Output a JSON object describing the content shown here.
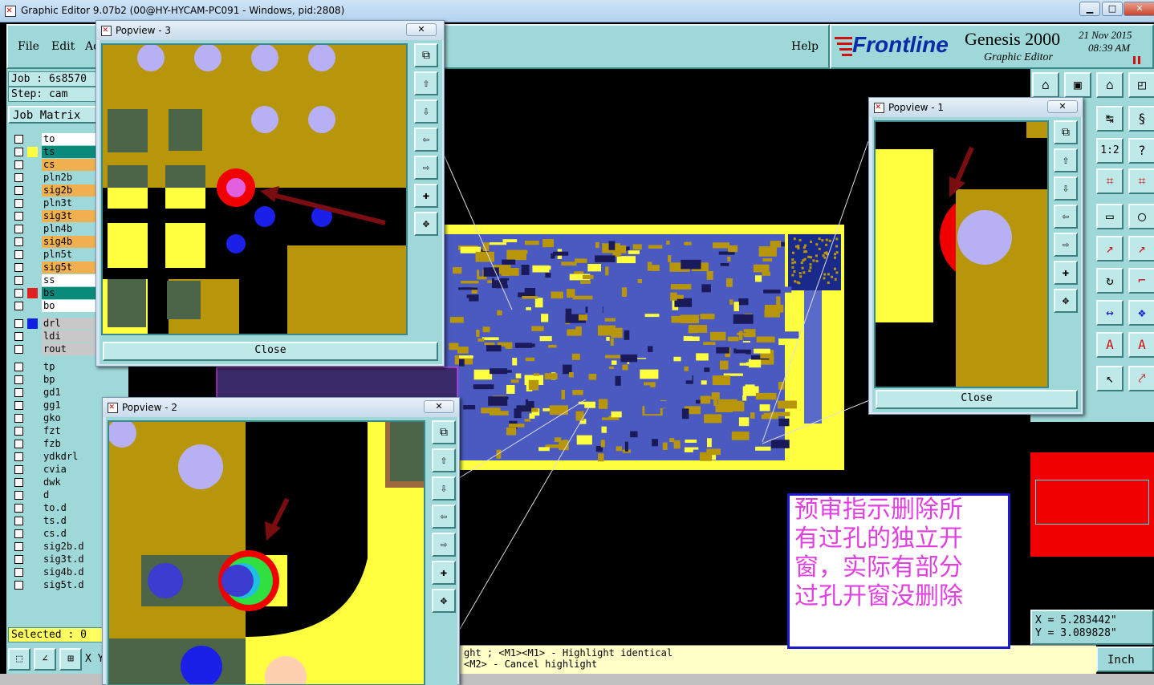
{
  "window": {
    "title": "Graphic Editor 9.07b2 (00@HY-HYCAM-PC091 - Windows, pid:2808)",
    "min": "▁",
    "max": "□",
    "close": "✕"
  },
  "menu": {
    "file": "File",
    "edit": "Edit",
    "actions": "Ac",
    "help": "Help"
  },
  "brand": {
    "logo": "Frontline",
    "product": "Genesis 2000",
    "subtitle": "Graphic Editor",
    "date": "21 Nov 2015",
    "time": "08:39 AM"
  },
  "job": {
    "job": "Job : 6s8570",
    "step": "Step: cam",
    "matrix_button": "Job Matrix"
  },
  "layers": [
    {
      "name": "to",
      "color": "#ffffff",
      "mark": ""
    },
    {
      "name": "ts",
      "color": "#0a8a7a",
      "mark": "#ffff40"
    },
    {
      "name": "cs",
      "color": "#f0b050",
      "mark": ""
    },
    {
      "name": "pln2b",
      "color": "#9ed8d8",
      "mark": ""
    },
    {
      "name": "sig2b",
      "color": "#f0b050",
      "mark": ""
    },
    {
      "name": "pln3t",
      "color": "#9ed8d8",
      "mark": ""
    },
    {
      "name": "sig3t",
      "color": "#f0b050",
      "mark": ""
    },
    {
      "name": "pln4b",
      "color": "#9ed8d8",
      "mark": ""
    },
    {
      "name": "sig4b",
      "color": "#f0b050",
      "mark": ""
    },
    {
      "name": "pln5t",
      "color": "#9ed8d8",
      "mark": ""
    },
    {
      "name": "sig5t",
      "color": "#f0b050",
      "mark": ""
    },
    {
      "name": "ss",
      "color": "#ffffff",
      "mark": ""
    },
    {
      "name": "bs",
      "color": "#0a8a7a",
      "mark": "#e02020"
    },
    {
      "name": "bo",
      "color": "#ffffff",
      "mark": ""
    },
    {
      "name": "drl",
      "color": "#c8c8c8",
      "mark": "#1020e0"
    },
    {
      "name": "ldi",
      "color": "#c8c8c8",
      "mark": ""
    },
    {
      "name": "rout",
      "color": "#c8c8c8",
      "mark": ""
    },
    {
      "name": "tp",
      "color": "#9ed8d8",
      "mark": ""
    },
    {
      "name": "bp",
      "color": "#9ed8d8",
      "mark": ""
    },
    {
      "name": "gd1",
      "color": "#9ed8d8",
      "mark": ""
    },
    {
      "name": "gg1",
      "color": "#9ed8d8",
      "mark": ""
    },
    {
      "name": "gko",
      "color": "#9ed8d8",
      "mark": ""
    },
    {
      "name": "fzt",
      "color": "#9ed8d8",
      "mark": ""
    },
    {
      "name": "fzb",
      "color": "#9ed8d8",
      "mark": ""
    },
    {
      "name": "ydkdrl",
      "color": "#9ed8d8",
      "mark": ""
    },
    {
      "name": "cvia",
      "color": "#9ed8d8",
      "mark": ""
    },
    {
      "name": "dwk",
      "color": "#9ed8d8",
      "mark": ""
    },
    {
      "name": "d",
      "color": "#9ed8d8",
      "mark": ""
    },
    {
      "name": "to.d",
      "color": "#9ed8d8",
      "mark": ""
    },
    {
      "name": "ts.d",
      "color": "#9ed8d8",
      "mark": ""
    },
    {
      "name": "cs.d",
      "color": "#9ed8d8",
      "mark": ""
    },
    {
      "name": "sig2b.d",
      "color": "#9ed8d8",
      "mark": ""
    },
    {
      "name": "sig3t.d",
      "color": "#9ed8d8",
      "mark": ""
    },
    {
      "name": "sig4b.d",
      "color": "#9ed8d8",
      "mark": ""
    },
    {
      "name": "sig5t.d",
      "color": "#9ed8d8",
      "mark": ""
    }
  ],
  "selected": "Selected : 0",
  "status": {
    "line1": "ght ; <M1><M1> - Highlight identical",
    "line2": "<M2> - Cancel highlight",
    "xy_label": "X Y",
    "units": "Inch"
  },
  "coords": {
    "x": "X = 5.283442\"",
    "y": "Y = 3.089828\""
  },
  "popups": {
    "p3": {
      "title": "Popview - 3",
      "close": "Close"
    },
    "p2": {
      "title": "Popview - 2"
    },
    "p1": {
      "title": "Popview - 1",
      "close": "Close"
    }
  },
  "note": {
    "lines": [
      "预审指示删除所",
      "有过孔的独立开",
      "窗，实际有部分",
      "过孔开窗没删除"
    ]
  },
  "tool_icons": [
    "zoom-home",
    "zoom-in",
    "zoom-out",
    "pan-left",
    "pan-right",
    "zoom-fit",
    "zoom-all"
  ],
  "colors": {
    "board_mask": "#b8960c",
    "pad_yellow": "#ffff40",
    "board_green": "#4c6448",
    "via_lilac": "#b8b0f4",
    "drill_blue": "#1a20e8",
    "cut_red": "#f00000",
    "arrow": "#7a0d10",
    "ui_teal": "#9ed8d8"
  }
}
